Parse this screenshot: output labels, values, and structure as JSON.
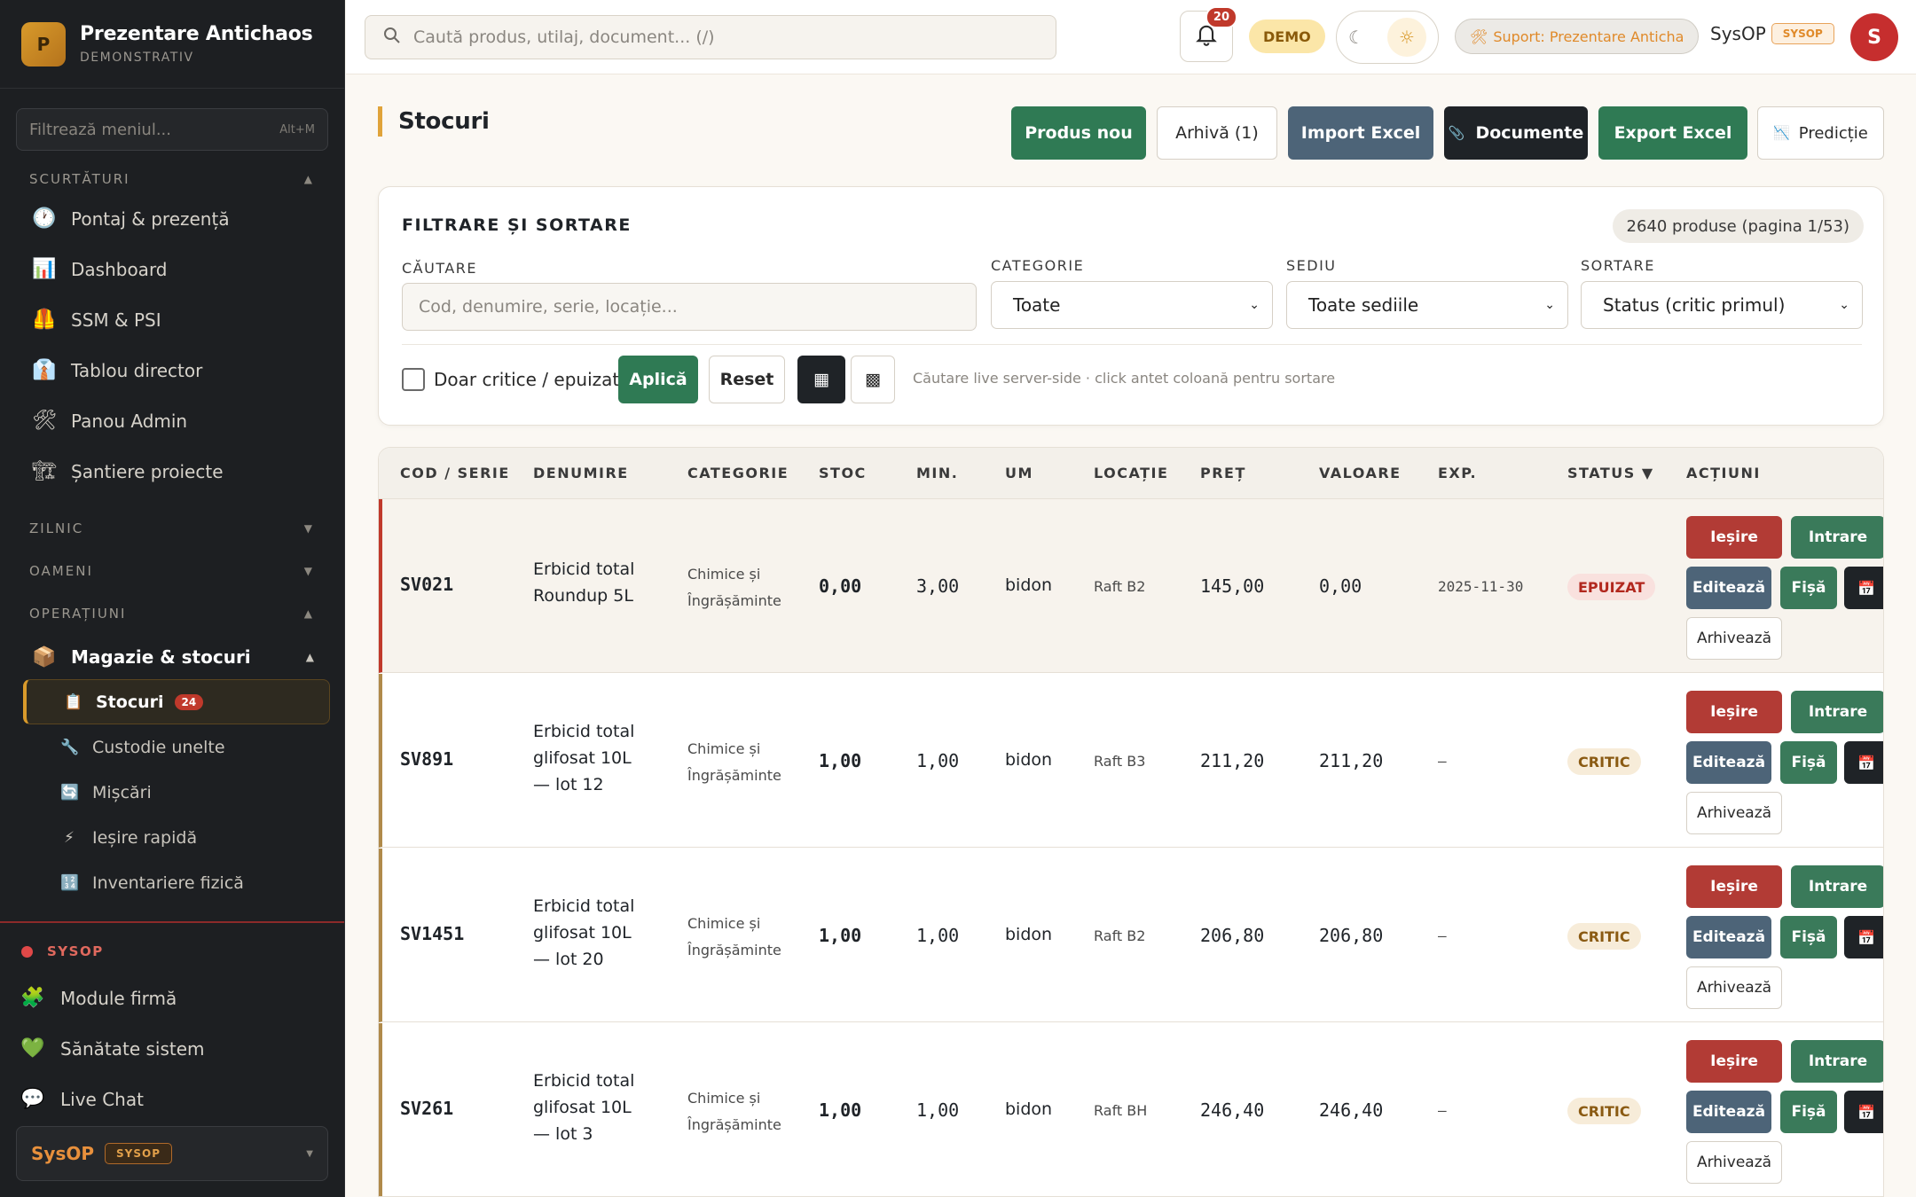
{
  "brand": {
    "initial": "P",
    "title": "Prezentare Antichaos",
    "subtitle": "DEMONSTRATIV"
  },
  "sidebar": {
    "filter_placeholder": "Filtrează meniul...",
    "filter_shortcut": "Alt+M",
    "sections": {
      "shortcuts": "SCURTĂTURI",
      "daily": "ZILNIC",
      "people": "OAMENI",
      "operations": "OPERAȚIUNI"
    },
    "shortcut_items": [
      {
        "icon": "🕐",
        "label": "Pontaj & prezență"
      },
      {
        "icon": "📊",
        "label": "Dashboard"
      },
      {
        "icon": "🦺",
        "label": "SSM & PSI"
      },
      {
        "icon": "👔",
        "label": "Tablou director"
      },
      {
        "icon": "🛠",
        "label": "Panou Admin"
      },
      {
        "icon": "🏗",
        "label": "Șantiere proiecte"
      }
    ],
    "ops_group": {
      "icon": "📦",
      "label": "Magazie & stocuri"
    },
    "ops_items": [
      {
        "icon": "📋",
        "label": "Stocuri",
        "badge": "24"
      },
      {
        "icon": "🔧",
        "label": "Custodie unelte"
      },
      {
        "icon": "🔄",
        "label": "Mișcări"
      },
      {
        "icon": "⚡",
        "label": "Ieșire rapidă"
      },
      {
        "icon": "🔢",
        "label": "Inventariere fizică"
      }
    ],
    "sysop_title": "SYSOP",
    "sysop_items": [
      {
        "icon": "🧩",
        "label": "Module firmă"
      },
      {
        "icon": "💚",
        "label": "Sănătate sistem"
      },
      {
        "icon": "💬",
        "label": "Live Chat"
      }
    ],
    "user": {
      "name": "SysOP",
      "role": "SYSOP"
    }
  },
  "topbar": {
    "search_placeholder": "Caută produs, utilaj, document... (/)",
    "notifications": "20",
    "demo": "DEMO",
    "support": "Suport: Prezentare Anticha",
    "user": "SysOP",
    "role": "SYSOP",
    "avatar": "S"
  },
  "page": {
    "title": "Stocuri"
  },
  "toolbar": {
    "new_product": "Produs nou",
    "archive": "Arhivă (1)",
    "import": "Import Excel",
    "documents": "Documente",
    "export": "Export Excel",
    "prediction": "Predicție"
  },
  "filters": {
    "title": "FILTRARE ȘI SORTARE",
    "count": "2640 produse (pagina 1/53)",
    "search_label": "CĂUTARE",
    "search_placeholder": "Cod, denumire, serie, locație...",
    "category_label": "CATEGORIE",
    "category_value": "Toate",
    "site_label": "SEDIU",
    "site_value": "Toate sediile",
    "sort_label": "SORTARE",
    "sort_value": "Status (critic primul)",
    "critical_only": "Doar critice / epuizate",
    "apply": "Aplică",
    "reset": "Reset",
    "hint": "Căutare live server-side · click antet coloană pentru sortare"
  },
  "table": {
    "headers": [
      "COD / SERIE",
      "DENUMIRE",
      "CATEGORIE",
      "STOC",
      "MIN.",
      "UM",
      "LOCAȚIE",
      "PREȚ",
      "VALOARE",
      "EXP.",
      "STATUS ▼",
      "ACȚIUNI"
    ],
    "rows": [
      {
        "code": "SV021",
        "name1": "Erbicid total",
        "name2": "Roundup 5L",
        "name3": "",
        "cat1": "Chimice și",
        "cat2": "Îngrășăminte",
        "stock": "0,00",
        "min": "3,00",
        "um": "bidon",
        "loc": "Raft B2",
        "price": "145,00",
        "value": "0,00",
        "exp": "2025-11-30",
        "status": "EPUIZAT"
      },
      {
        "code": "SV891",
        "name1": "Erbicid total",
        "name2": "glifosat 10L",
        "name3": "— lot 12",
        "cat1": "Chimice și",
        "cat2": "Îngrășăminte",
        "stock": "1,00",
        "min": "1,00",
        "um": "bidon",
        "loc": "Raft B3",
        "price": "211,20",
        "value": "211,20",
        "exp": "—",
        "status": "CRITIC"
      },
      {
        "code": "SV1451",
        "name1": "Erbicid total",
        "name2": "glifosat 10L",
        "name3": "— lot 20",
        "cat1": "Chimice și",
        "cat2": "Îngrășăminte",
        "stock": "1,00",
        "min": "1,00",
        "um": "bidon",
        "loc": "Raft B2",
        "price": "206,80",
        "value": "206,80",
        "exp": "—",
        "status": "CRITIC"
      },
      {
        "code": "SV261",
        "name1": "Erbicid total",
        "name2": "glifosat 10L",
        "name3": "— lot 3",
        "cat1": "Chimice și",
        "cat2": "Îngrășăminte",
        "stock": "1,00",
        "min": "1,00",
        "um": "bidon",
        "loc": "Raft BH",
        "price": "246,40",
        "value": "246,40",
        "exp": "—",
        "status": "CRITIC"
      }
    ],
    "actions": {
      "out": "Ieșire",
      "in": "Intrare",
      "edit": "Editează",
      "sheet": "Fișă",
      "calendar_icon": "📅",
      "archive": "Arhivează"
    }
  },
  "colors": {
    "accent": "#d99a2b",
    "green": "#3a7a5a",
    "red": "#b23b35",
    "slate": "#4d6478",
    "sidebar": "#1d1f22"
  }
}
